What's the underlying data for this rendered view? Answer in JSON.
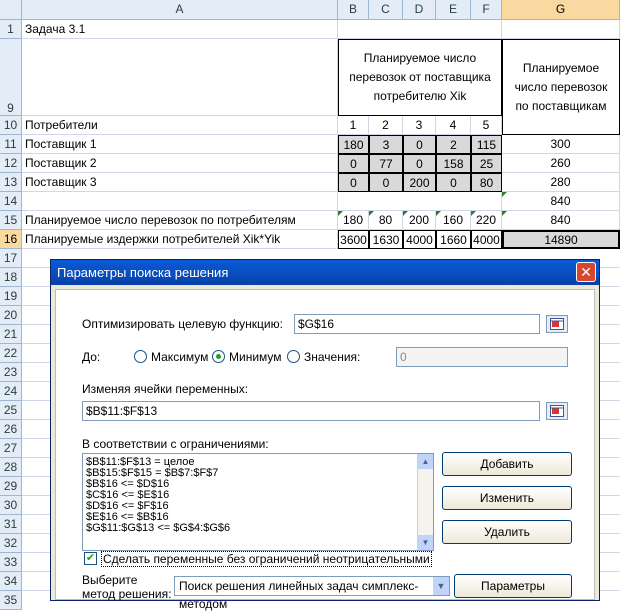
{
  "columns": [
    "A",
    "B",
    "C",
    "D",
    "E",
    "F",
    "G"
  ],
  "rows": [
    "1",
    "9",
    "10",
    "11",
    "12",
    "13",
    "14",
    "15",
    "16",
    "17",
    "18",
    "19",
    "20",
    "21",
    "22",
    "23",
    "24",
    "25",
    "26",
    "27",
    "28",
    "29",
    "30",
    "31",
    "32",
    "33",
    "34",
    "35"
  ],
  "sheet": {
    "a1": "Задача 3.1",
    "header_mid": "Планируемое число перевозок от поставщика потребителю Xik",
    "header_right": "Планируемое число перевозок по поставщикам",
    "a10": "Потребители",
    "consumers": [
      "1",
      "2",
      "3",
      "4",
      "5"
    ],
    "suppliers": [
      {
        "name": "Поставщик 1",
        "vals": [
          "180",
          "3",
          "0",
          "2",
          "115"
        ],
        "total": "300"
      },
      {
        "name": "Поставщик 2",
        "vals": [
          "0",
          "77",
          "0",
          "158",
          "25"
        ],
        "total": "260"
      },
      {
        "name": "Поставщик 3",
        "vals": [
          "0",
          "0",
          "200",
          "0",
          "80"
        ],
        "total": "280"
      }
    ],
    "g14": "840",
    "a15": "Планируемое число перевозок по потребителям",
    "row15": [
      "180",
      "80",
      "200",
      "160",
      "220"
    ],
    "g15": "840",
    "a16": "Планируемые издержки потребителей Xik*Yik",
    "row16": [
      "3600",
      "1630",
      "4000",
      "1660",
      "4000"
    ],
    "g16": "14890"
  },
  "dialog": {
    "title": "Параметры поиска решения",
    "objective_label": "Оптимизировать целевую функцию:",
    "objective_value": "$G$16",
    "to_label": "До:",
    "radio_max": "Максимум",
    "radio_min": "Минимум",
    "radio_values": "Значения:",
    "values_field": "0",
    "changing_label": "Изменяя ячейки переменных:",
    "changing_value": "$B$11:$F$13",
    "constraints_label": "В соответствии с ограничениями:",
    "constraints": [
      "$B$11:$F$13 = целое",
      "$B$15:$F$15 = $B$7:$F$7",
      "$B$16 <= $D$16",
      "$C$16 <= $E$16",
      "$D$16 <= $F$16",
      "$E$16 <= $B$16",
      "$G$11:$G$13 <= $G$4:$G$6"
    ],
    "add_button": "Добавить",
    "change_button": "Изменить",
    "delete_button": "Удалить",
    "nonneg_checkbox": "Сделать переменные без ограничений неотрицательными",
    "method_label_1": "Выберите",
    "method_label_2": "метод решения:",
    "method_value": "Поиск решения линейных задач симплекс-методом",
    "params_button": "Параметры"
  },
  "colors": {
    "header_bg": "#e4ecf7",
    "selected_header": "#f9d99f",
    "gray_cell": "#d9d9d9",
    "titlebar": "#0a5bd8"
  }
}
